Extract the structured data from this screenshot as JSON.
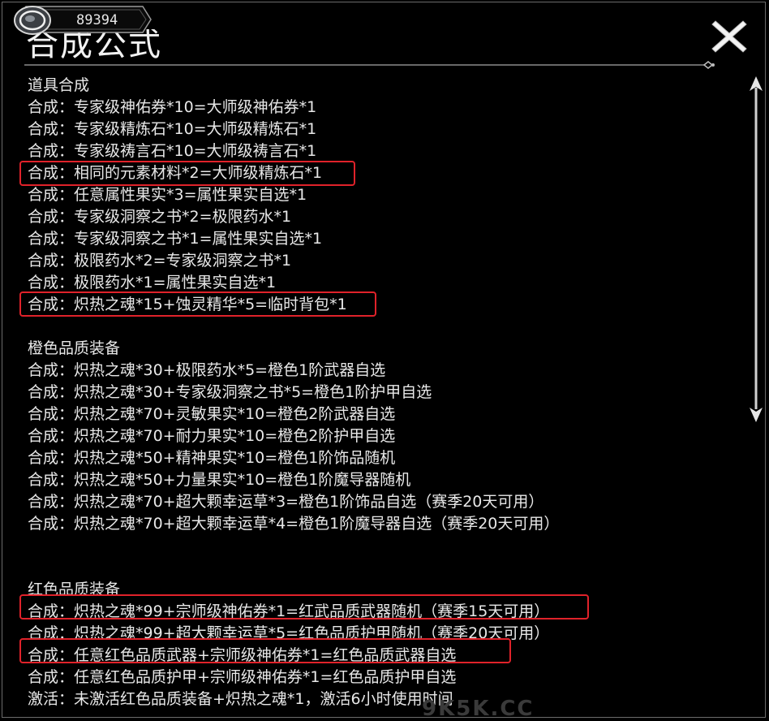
{
  "header": {
    "title": "合成公式",
    "currency_amount": "89394"
  },
  "sections": [
    {
      "heading": "道具合成",
      "lines": [
        "合成：专家级神佑券*10=大师级神佑券*1",
        "合成：专家级精炼石*10=大师级精炼石*1",
        "合成：专家级祷言石*10=大师级祷言石*1",
        "合成：相同的元素材料*2=大师级精炼石*1",
        "合成：任意属性果实*3=属性果实自选*1",
        "合成：专家级洞察之书*2=极限药水*1",
        "合成：专家级洞察之书*1=属性果实自选*1",
        "合成：极限药水*2=专家级洞察之书*1",
        "合成：极限药水*1=属性果实自选*1",
        "合成：炽热之魂*15+蚀灵精华*5=临时背包*1"
      ]
    },
    {
      "heading": "橙色品质装备",
      "lines": [
        "合成：炽热之魂*30+极限药水*5=橙色1阶武器自选",
        "合成：炽热之魂*30+专家级洞察之书*5=橙色1阶护甲自选",
        "合成：炽热之魂*70+灵敏果实*10=橙色2阶武器自选",
        "合成：炽热之魂*70+耐力果实*10=橙色2阶护甲自选",
        "合成：炽热之魂*50+精神果实*10=橙色1阶饰品随机",
        "合成：炽热之魂*50+力量果实*10=橙色1阶魔导器随机",
        "合成：炽热之魂*70+超大颗幸运草*3=橙色1阶饰品自选（赛季20天可用）",
        "合成：炽热之魂*70+超大颗幸运草*4=橙色1阶魔导器自选（赛季20天可用）"
      ]
    },
    {
      "heading": "红色品质装备",
      "lines": [
        "合成：炽热之魂*99+宗师级神佑券*1=红武品质武器随机（赛季15天可用）",
        "合成：炽热之魂*99+超大颗幸运草*5=红色品质护甲随机（赛季20天可用）",
        "合成：任意红色品质武器+宗师级神佑券*1=红色品质武器自选",
        "合成：任意红色品质护甲+宗师级神佑券*1=红色品质护甲自选",
        "激活：未激活红色品质装备+炽热之魂*1，激活6小时使用时间"
      ]
    }
  ],
  "watermark": "9K5K.CC",
  "colors": {
    "background": "#000000",
    "text": "#e8e8e8",
    "highlight": "#e0222a"
  },
  "icons": [
    "coin-icon",
    "close-icon",
    "scroll-arrow-up-icon",
    "scroll-arrow-down-icon"
  ]
}
